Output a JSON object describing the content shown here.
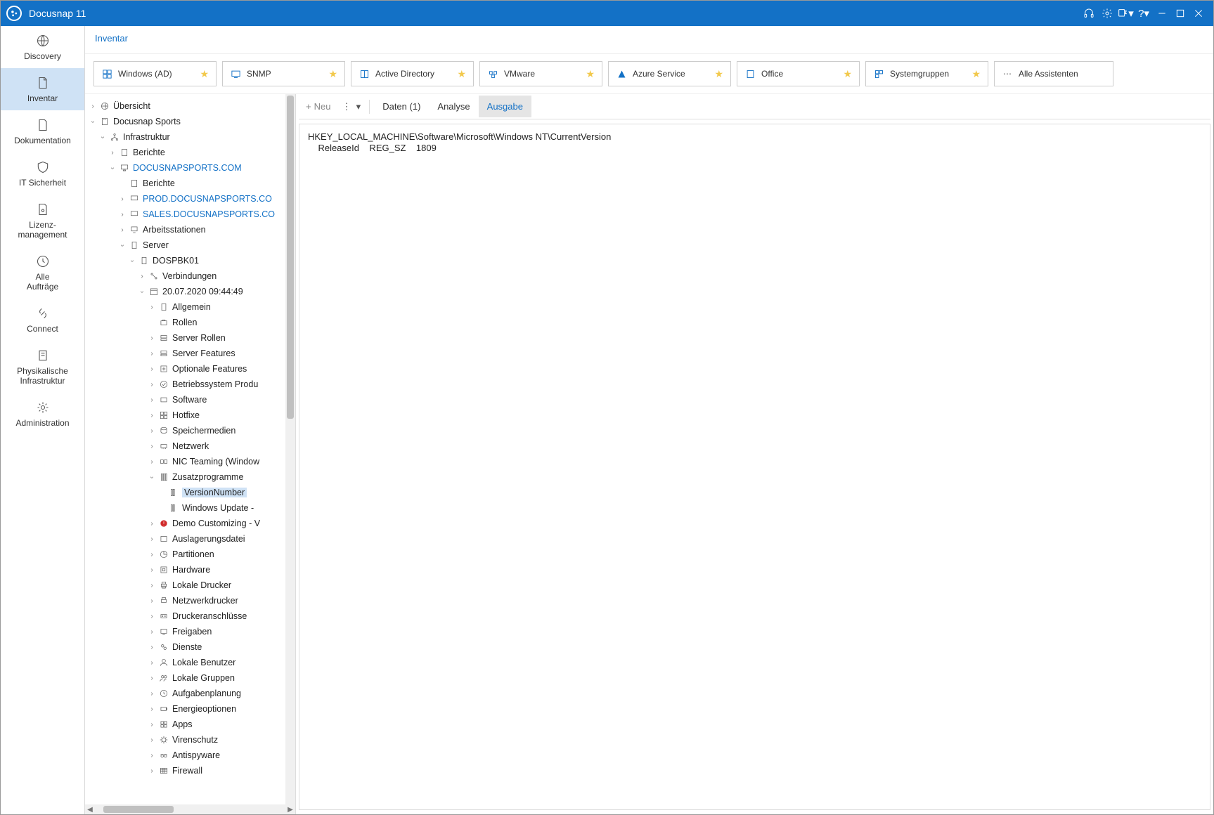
{
  "titlebar": {
    "title": "Docusnap 11"
  },
  "leftnav": {
    "items": [
      {
        "label": "Discovery"
      },
      {
        "label": "Inventar"
      },
      {
        "label": "Dokumentation"
      },
      {
        "label": "IT Sicherheit"
      },
      {
        "label": "Lizenz-\nmanagement"
      },
      {
        "label": "Alle\nAufträge"
      },
      {
        "label": "Connect"
      },
      {
        "label": "Physikalische\nInfrastruktur"
      },
      {
        "label": "Administration"
      }
    ]
  },
  "breadcrumb": "Inventar",
  "cards": [
    {
      "label": "Windows (AD)"
    },
    {
      "label": "SNMP"
    },
    {
      "label": "Active Directory"
    },
    {
      "label": "VMware"
    },
    {
      "label": "Azure Service"
    },
    {
      "label": "Office"
    },
    {
      "label": "Systemgruppen"
    },
    {
      "label": "Alle Assistenten"
    }
  ],
  "tabs": {
    "neu": "Neu",
    "daten": "Daten (1)",
    "analyse": "Analyse",
    "ausgabe": "Ausgabe"
  },
  "output_line1": "HKEY_LOCAL_MACHINE\\Software\\Microsoft\\Windows NT\\CurrentVersion",
  "output_line2": "    ReleaseId    REG_SZ    1809",
  "tree": {
    "root": "Übersicht",
    "company": "Docusnap Sports",
    "infra": "Infrastruktur",
    "berichte": "Berichte",
    "domain": "DOCUSNAPSPORTS.COM",
    "berichte2": "Berichte",
    "prod": "PROD.DOCUSNAPSPORTS.CO",
    "sales": "SALES.DOCUSNAPSPORTS.CO",
    "arbeits": "Arbeitsstationen",
    "server": "Server",
    "host": "DOSPBK01",
    "verbindungen": "Verbindungen",
    "scan": "20.07.2020 09:44:49",
    "allgemein": "Allgemein",
    "rollen": "Rollen",
    "serverrollen": "Server Rollen",
    "serverfeat": "Server Features",
    "optfeat": "Optionale Features",
    "osprod": "Betriebssystem Produ",
    "software": "Software",
    "hotfixe": "Hotfixe",
    "speicher": "Speichermedien",
    "netzwerk": "Netzwerk",
    "nicteam": "NIC Teaming (Window",
    "zusatz": "Zusatzprogramme",
    "version": "VersionNumber",
    "winupdate": "Windows Update -",
    "demo": "Demo Customizing - V",
    "auslager": "Auslagerungsdatei",
    "partitionen": "Partitionen",
    "hardware": "Hardware",
    "ldrucker": "Lokale Drucker",
    "ndrucker": "Netzwerkdrucker",
    "druckanschl": "Druckeranschlüsse",
    "freigaben": "Freigaben",
    "dienste": "Dienste",
    "lbenutzer": "Lokale Benutzer",
    "lgruppen": "Lokale Gruppen",
    "aufgaben": "Aufgabenplanung",
    "energie": "Energieoptionen",
    "apps": "Apps",
    "viren": "Virenschutz",
    "antispy": "Antispyware",
    "firewall": "Firewall"
  }
}
